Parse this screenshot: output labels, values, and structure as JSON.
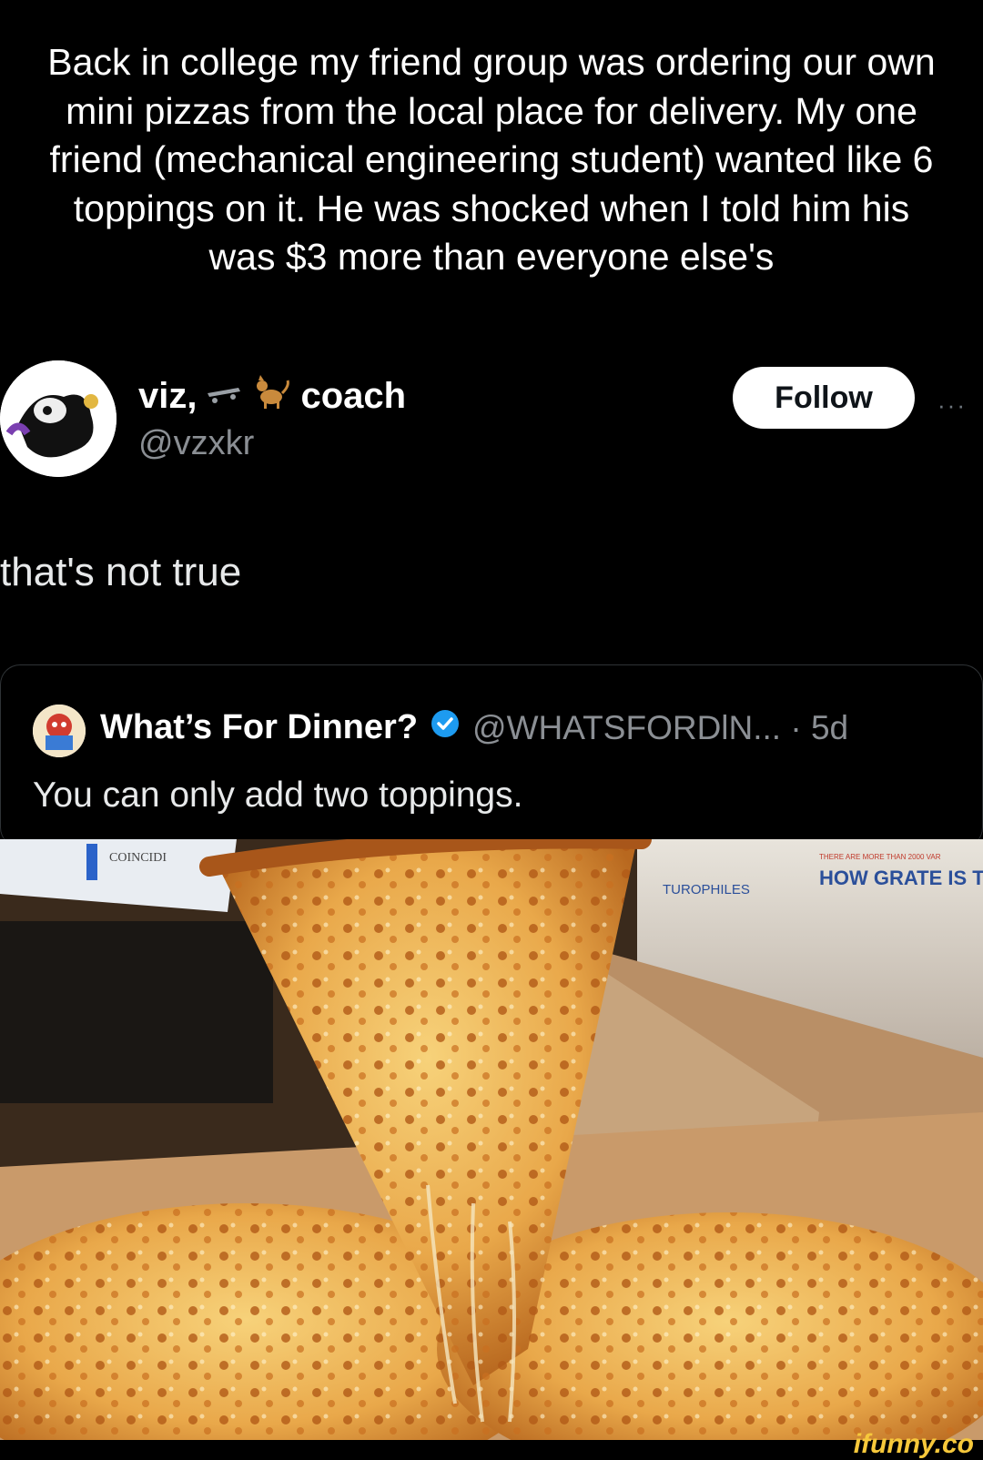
{
  "caption": "Back in college my friend group was ordering our own mini pizzas from the local place for delivery. My one friend (mechanical engineering student) wanted like 6 toppings on it. He was shocked when I told him his was $3 more than everyone else's",
  "tweet": {
    "name_prefix": "viz,",
    "name_suffix": "coach",
    "handle": "@vzxkr",
    "follow_label": "Follow",
    "more_label": "···",
    "text": "that's not true"
  },
  "quoted_tweet": {
    "name": "What’s For Dinner?",
    "handle_time": "@WHATSFORDlN... · 5d",
    "text": "You can only add two toppings."
  },
  "photo": {
    "left_box_text": "COINCIDI",
    "right_box_brand": "TUROPHILES",
    "right_box_slogan": "HOW GRATE IS TH",
    "right_box_small": "THERE ARE MORE THAN 2000 VAR"
  },
  "watermark": "ifunny.co",
  "colors": {
    "follow_bg": "#ffffff",
    "verified": "#1d9bf0",
    "muted": "#8b8f94"
  },
  "icons": [
    "skateboard-icon",
    "dog-icon",
    "verified-badge-icon",
    "more-icon"
  ]
}
